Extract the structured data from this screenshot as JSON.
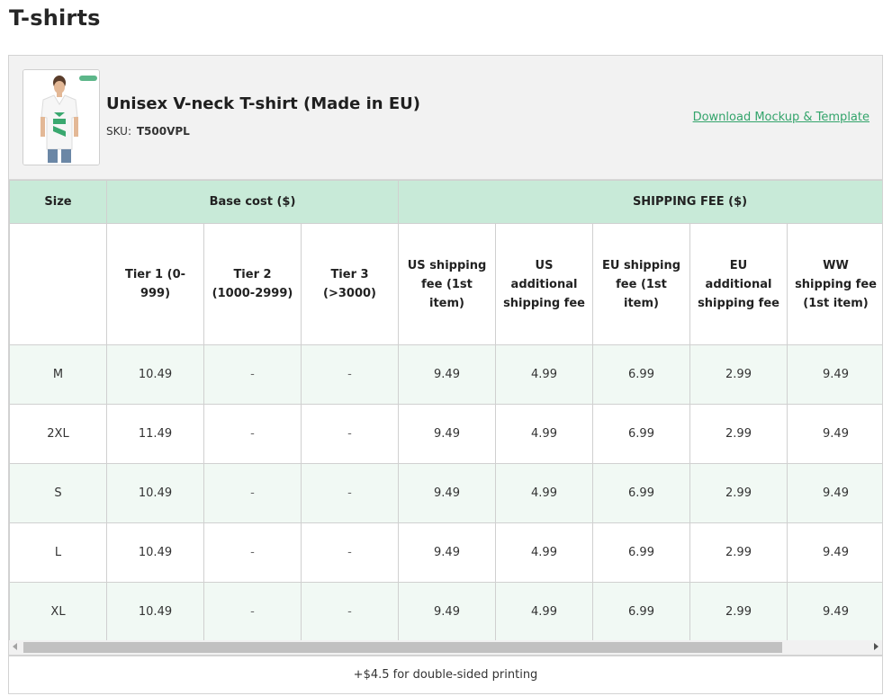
{
  "page": {
    "title": "T-shirts"
  },
  "product": {
    "name": "Unisex V-neck T-shirt (Made in EU)",
    "sku_label": "SKU:",
    "sku_value": "T500VPL",
    "download_link": "Download Mockup & Template",
    "thumbnail_icon": "tshirt-model-photo",
    "brand_color": "#33a46b"
  },
  "table": {
    "group_headers": {
      "size": "Size",
      "base_cost": "Base cost ($)",
      "shipping": "SHIPPING FEE ($)"
    },
    "sub_headers": {
      "tier1": "Tier 1 (0-999)",
      "tier2": "Tier 2 (1000-2999)",
      "tier3": "Tier 3 (>3000)",
      "us_first": "US shipping fee (1st item)",
      "us_additional": "US additional shipping fee",
      "eu_first": "EU shipping fee (1st item)",
      "eu_additional": "EU additional shipping fee",
      "ww_first": "WW shipping fee (1st item)"
    },
    "rows": [
      {
        "size": "M",
        "tier1": "10.49",
        "tier2": "-",
        "tier3": "-",
        "us_first": "9.49",
        "us_additional": "4.99",
        "eu_first": "6.99",
        "eu_additional": "2.99",
        "ww_first": "9.49"
      },
      {
        "size": "2XL",
        "tier1": "11.49",
        "tier2": "-",
        "tier3": "-",
        "us_first": "9.49",
        "us_additional": "4.99",
        "eu_first": "6.99",
        "eu_additional": "2.99",
        "ww_first": "9.49"
      },
      {
        "size": "S",
        "tier1": "10.49",
        "tier2": "-",
        "tier3": "-",
        "us_first": "9.49",
        "us_additional": "4.99",
        "eu_first": "6.99",
        "eu_additional": "2.99",
        "ww_first": "9.49"
      },
      {
        "size": "L",
        "tier1": "10.49",
        "tier2": "-",
        "tier3": "-",
        "us_first": "9.49",
        "us_additional": "4.99",
        "eu_first": "6.99",
        "eu_additional": "2.99",
        "ww_first": "9.49"
      },
      {
        "size": "XL",
        "tier1": "10.49",
        "tier2": "-",
        "tier3": "-",
        "us_first": "9.49",
        "us_additional": "4.99",
        "eu_first": "6.99",
        "eu_additional": "2.99",
        "ww_first": "9.49"
      }
    ],
    "header_color": "#c8ead8",
    "alt_row_color": "#f1f9f4"
  },
  "footer": {
    "note": "+$4.5 for double-sided printing"
  }
}
